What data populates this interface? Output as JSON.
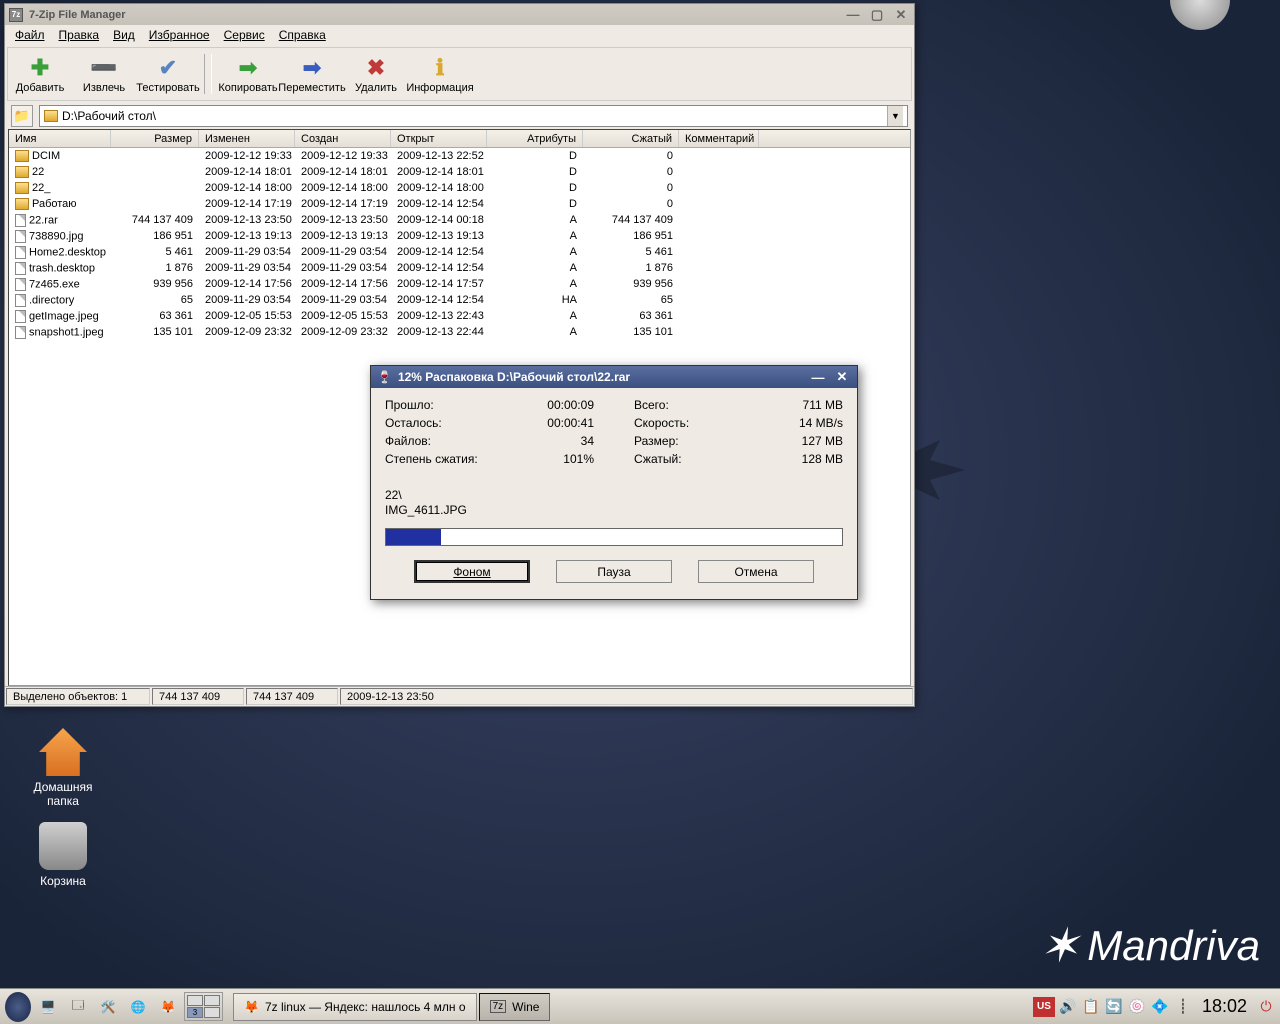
{
  "desktop": {
    "home_label": "Домашняя\nпапка",
    "trash_label": "Корзина",
    "brand": "Mandriva"
  },
  "window": {
    "title": "7-Zip File Manager",
    "menu": [
      "Файл",
      "Правка",
      "Вид",
      "Избранное",
      "Сервис",
      "Справка"
    ],
    "tools": {
      "add": "Добавить",
      "extract": "Извлечь",
      "test": "Тестировать",
      "copy": "Копировать",
      "move": "Переместить",
      "del": "Удалить",
      "info": "Информация"
    },
    "path": "D:\\Рабочий стол\\",
    "columns": [
      "Имя",
      "Размер",
      "Изменен",
      "Создан",
      "Открыт",
      "Атрибуты",
      "Сжатый",
      "Комментарий"
    ],
    "rows": [
      {
        "icon": "folder",
        "name": "DCIM",
        "size": "",
        "mod": "2009-12-12 19:33",
        "cre": "2009-12-12 19:33",
        "open": "2009-12-13 22:52",
        "attr": "D",
        "packed": "0"
      },
      {
        "icon": "folder",
        "name": "22",
        "size": "",
        "mod": "2009-12-14 18:01",
        "cre": "2009-12-14 18:01",
        "open": "2009-12-14 18:01",
        "attr": "D",
        "packed": "0"
      },
      {
        "icon": "folder",
        "name": "22_",
        "size": "",
        "mod": "2009-12-14 18:00",
        "cre": "2009-12-14 18:00",
        "open": "2009-12-14 18:00",
        "attr": "D",
        "packed": "0"
      },
      {
        "icon": "folder",
        "name": "Работаю",
        "size": "",
        "mod": "2009-12-14 17:19",
        "cre": "2009-12-14 17:19",
        "open": "2009-12-14 12:54",
        "attr": "D",
        "packed": "0"
      },
      {
        "icon": "file",
        "name": "22.rar",
        "size": "744 137 409",
        "mod": "2009-12-13 23:50",
        "cre": "2009-12-13 23:50",
        "open": "2009-12-14 00:18",
        "attr": "A",
        "packed": "744 137 409"
      },
      {
        "icon": "file",
        "name": "738890.jpg",
        "size": "186 951",
        "mod": "2009-12-13 19:13",
        "cre": "2009-12-13 19:13",
        "open": "2009-12-13 19:13",
        "attr": "A",
        "packed": "186 951"
      },
      {
        "icon": "file",
        "name": "Home2.desktop",
        "size": "5 461",
        "mod": "2009-11-29 03:54",
        "cre": "2009-11-29 03:54",
        "open": "2009-12-14 12:54",
        "attr": "A",
        "packed": "5 461"
      },
      {
        "icon": "file",
        "name": "trash.desktop",
        "size": "1 876",
        "mod": "2009-11-29 03:54",
        "cre": "2009-11-29 03:54",
        "open": "2009-12-14 12:54",
        "attr": "A",
        "packed": "1 876"
      },
      {
        "icon": "file",
        "name": "7z465.exe",
        "size": "939 956",
        "mod": "2009-12-14 17:56",
        "cre": "2009-12-14 17:56",
        "open": "2009-12-14 17:57",
        "attr": "A",
        "packed": "939 956"
      },
      {
        "icon": "file",
        "name": ".directory",
        "size": "65",
        "mod": "2009-11-29 03:54",
        "cre": "2009-11-29 03:54",
        "open": "2009-12-14 12:54",
        "attr": "HA",
        "packed": "65"
      },
      {
        "icon": "file",
        "name": "getImage.jpeg",
        "size": "63 361",
        "mod": "2009-12-05 15:53",
        "cre": "2009-12-05 15:53",
        "open": "2009-12-13 22:43",
        "attr": "A",
        "packed": "63 361"
      },
      {
        "icon": "file",
        "name": "snapshot1.jpeg",
        "size": "135 101",
        "mod": "2009-12-09 23:32",
        "cre": "2009-12-09 23:32",
        "open": "2009-12-13 22:44",
        "attr": "A",
        "packed": "135 101"
      }
    ],
    "status": {
      "sel": "Выделено объектов: 1",
      "s1": "744 137 409",
      "s2": "744 137 409",
      "s3": "2009-12-13 23:50"
    }
  },
  "dialog": {
    "title": "12% Распаковка D:\\Рабочий стол\\22.rar",
    "labels": {
      "elapsed": "Прошло:",
      "remain": "Осталось:",
      "files": "Файлов:",
      "ratio": "Степень сжатия:",
      "total": "Всего:",
      "speed": "Скорость:",
      "size": "Размер:",
      "packed": "Сжатый:"
    },
    "values": {
      "elapsed": "00:00:09",
      "remain": "00:00:41",
      "files": "34",
      "ratio": "101%",
      "total": "711 MB",
      "speed": "14 MB/s",
      "size": "127 MB",
      "packed": "128 MB"
    },
    "current_dir": "22\\",
    "current_file": "IMG_4611.JPG",
    "progress_pct": 12,
    "buttons": {
      "bg": "Фоном",
      "pause": "Пауза",
      "cancel": "Отмена"
    }
  },
  "taskbar": {
    "task1": "7z linux — Яндекс: нашлось 4 млн о",
    "task2": "Wine",
    "lang": "US",
    "clock": "18:02",
    "pager_badge": "3"
  }
}
